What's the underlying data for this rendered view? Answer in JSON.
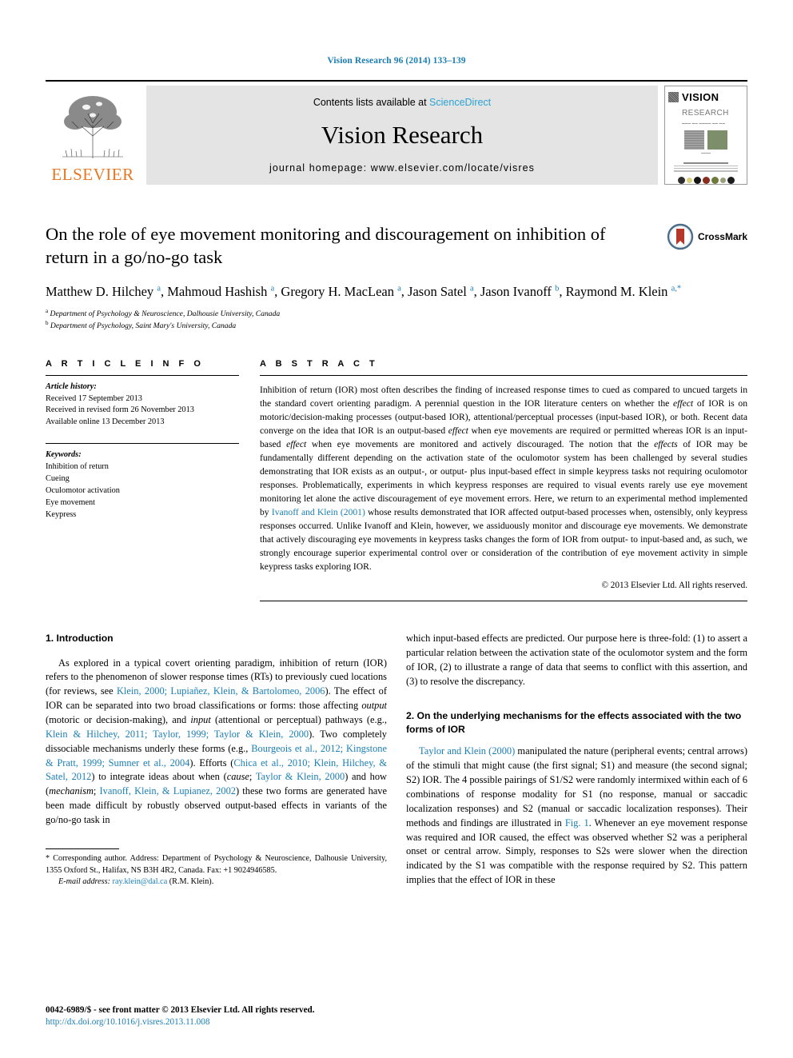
{
  "running_head": "Vision Research 96 (2014) 133–139",
  "masthead": {
    "publisher_name": "ELSEVIER",
    "contents_prefix": "Contents lists available at ",
    "contents_link": "ScienceDirect",
    "journal_title": "Vision Research",
    "homepage_line": "journal homepage: www.elsevier.com/locate/visres",
    "cover": {
      "title_line1": "VISION",
      "title_line2": "RESEARCH"
    }
  },
  "crossmark": {
    "label": "CrossMark"
  },
  "article": {
    "title": "On the role of eye movement monitoring and discouragement on inhibition of return in a go/no-go task",
    "authors_html": "Matthew D. Hilchey <sup>a</sup>, Mahmoud Hashish <sup>a</sup>, Gregory H. MacLean <sup>a</sup>, Jason Satel <sup>a</sup>, Jason Ivanoff <sup>b</sup>, Raymond M. Klein <sup>a,*</sup>",
    "affiliation_a": "Department of Psychology & Neuroscience, Dalhousie University, Canada",
    "affiliation_b": "Department of Psychology, Saint Mary's University, Canada"
  },
  "article_info": {
    "label": "A R T I C L E   I N F O",
    "history_head": "Article history:",
    "history": [
      "Received 17 September 2013",
      "Received in revised form 26 November 2013",
      "Available online 13 December 2013"
    ],
    "keywords_head": "Keywords:",
    "keywords": [
      "Inhibition of return",
      "Cueing",
      "Oculomotor activation",
      "Eye movement",
      "Keypress"
    ]
  },
  "abstract": {
    "label": "A B S T R A C T",
    "body_html": "Inhibition of return (IOR) most often describes the finding of increased response times to cued as compared to uncued targets in the standard covert orienting paradigm. A perennial question in the IOR literature centers on whether the <em>effect</em> of IOR is on motoric/decision-making processes (output-based IOR), attentional/perceptual processes (input-based IOR), or both. Recent data converge on the idea that IOR is an output-based <em>effect</em> when eye movements are required or permitted whereas IOR is an input-based <em>effect</em> when eye movements are monitored and actively discouraged. The notion that the <em>effects</em> of IOR may be fundamentally different depending on the activation state of the oculomotor system has been challenged by several studies demonstrating that IOR exists as an output-, or output- plus input-based effect in simple keypress tasks not requiring oculomotor responses. Problematically, experiments in which keypress responses are required to visual events rarely use eye movement monitoring let alone the active discouragement of eye movement errors. Here, we return to an experimental method implemented by <span class=\"ref\">Ivanoff and Klein (2001)</span> whose results demonstrated that IOR affected output-based processes when, ostensibly, only keypress responses occurred. Unlike Ivanoff and Klein, however, we assiduously monitor and discourage eye movements. We demonstrate that actively discouraging eye movements in keypress tasks changes the form of IOR from output- to input-based and, as such, we strongly encourage superior experimental control over or consideration of the contribution of eye movement activity in simple keypress tasks exploring IOR.",
    "copyright": "© 2013 Elsevier Ltd. All rights reserved."
  },
  "sections": {
    "intro_head": "1. Introduction",
    "intro_p1_html": "As explored in a typical covert orienting paradigm, inhibition of return (IOR) refers to the phenomenon of slower response times (RTs) to previously cued locations (for reviews, see <span class=\"ref\">Klein, 2000; Lupiañez, Klein, &amp; Bartolomeo, 2006</span>). The effect of IOR can be separated into two broad classifications or forms: those affecting <em>output</em> (motoric or decision-making), and <em>input</em> (attentional or perceptual) pathways (e.g., <span class=\"ref\">Klein &amp; Hilchey, 2011; Taylor, 1999; Taylor &amp; Klein, 2000</span>). Two completely dissociable mechanisms underly these forms (e.g., <span class=\"ref\">Bourgeois et al., 2012; Kingstone &amp; Pratt, 1999; Sumner et al., 2004</span>). Efforts (<span class=\"ref\">Chica et al., 2010; Klein, Hilchey, &amp; Satel, 2012</span>) to integrate ideas about when (<em>cause</em>; <span class=\"ref\">Taylor &amp; Klein, 2000</span>) and how (<em>mechanism</em>; <span class=\"ref\">Ivanoff, Klein, &amp; Lupianez, 2002</span>) these two forms are generated have been made difficult by robustly observed output-based effects in variants of the go/no-go task in which input-based effects are predicted. Our purpose here is three-fold: (1) to assert a particular relation between the activation state of the oculomotor system and the form of IOR, (2) to illustrate a range of data that seems to conflict with this assertion, and (3) to resolve the discrepancy.",
    "sec2_head": "2. On the underlying mechanisms for the effects associated with the two forms of IOR",
    "sec2_p1_html": "<span class=\"ref\">Taylor and Klein (2000)</span> manipulated the nature (peripheral events; central arrows) of the stimuli that might cause (the first signal; S1) and measure (the second signal; S2) IOR. The 4 possible pairings of S1/S2 were randomly intermixed within each of 6 combinations of response modality for S1 (no response, manual or saccadic localization responses) and S2 (manual or saccadic localization responses). Their methods and findings are illustrated in <span class=\"ref\">Fig. 1</span>. Whenever an eye movement response was required and IOR caused, the effect was observed whether S2 was a peripheral onset or central arrow. Simply, responses to S2s were slower when the direction indicated by the S1 was compatible with the response required by S2. This pattern implies that the effect of IOR in these"
  },
  "footnote": {
    "corresponding_html": "* Corresponding author. Address: Department of Psychology &amp; Neuroscience, Dalhousie University, 1355 Oxford St., Halifax, NS B3H 4R2, Canada. Fax: +1 9024946585.",
    "email_label": "E-mail address:",
    "email": "ray.klein@dal.ca",
    "email_suffix": "(R.M. Klein)."
  },
  "page_footer": {
    "issn_line": "0042-6989/$ - see front matter © 2013 Elsevier Ltd. All rights reserved.",
    "doi": "http://dx.doi.org/10.1016/j.visres.2013.11.008"
  },
  "colors": {
    "link": "#1a7eb5",
    "sciencedirect": "#2aa3d4",
    "elsevier_orange": "#e87722",
    "masthead_bg": "#e4e4e4",
    "crossmark_red": "#b5372a"
  }
}
